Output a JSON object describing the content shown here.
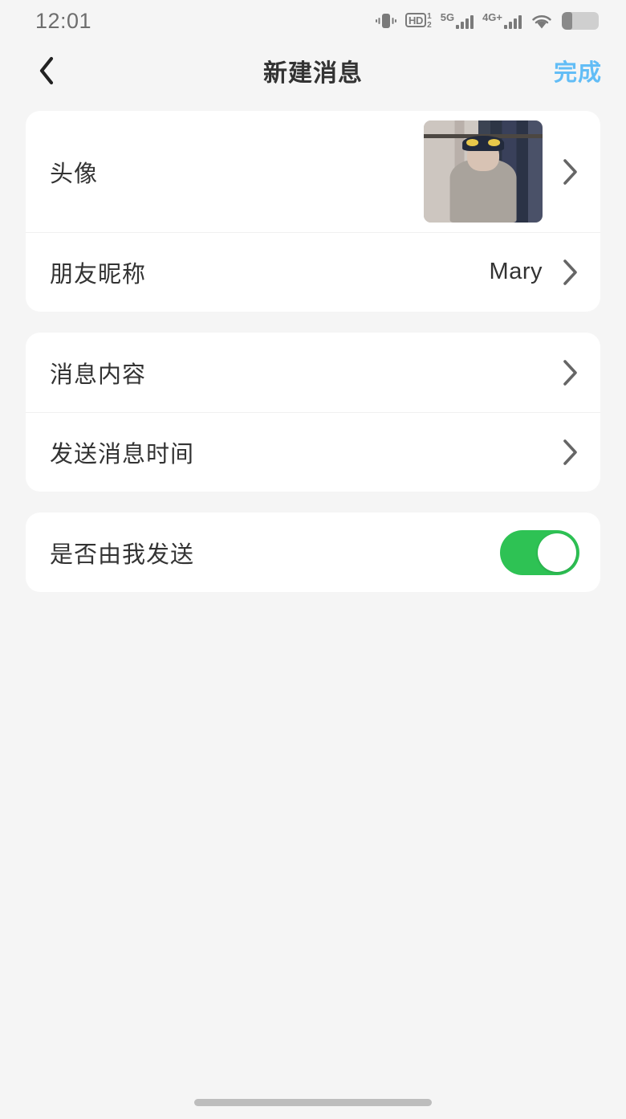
{
  "status_bar": {
    "time": "12:01",
    "icons": [
      {
        "name": "vibrate-icon"
      },
      {
        "name": "hd-voice-icon",
        "label": "HD",
        "sup": "1",
        "sub": "2"
      },
      {
        "name": "signal-5g-icon",
        "label": "5G"
      },
      {
        "name": "signal-4g-plus-icon",
        "label": "4G+"
      },
      {
        "name": "wifi-icon"
      },
      {
        "name": "battery-icon"
      }
    ]
  },
  "nav": {
    "back_icon": "chevron-left-icon",
    "title": "新建消息",
    "done_label": "完成",
    "done_color": "#62bdf6"
  },
  "colors": {
    "page_background": "#f5f5f5",
    "card_background": "#ffffff",
    "label_text": "#333333",
    "divider": "#f0f0f0",
    "toggle_on": "#2ec254",
    "accent": "#62bdf6",
    "chevron": "#666666"
  },
  "cards": [
    {
      "name": "profile-card",
      "rows": [
        {
          "name": "avatar-row",
          "label": "头像",
          "value": "",
          "control": "avatar-thumbnail",
          "chevron": true,
          "tall": true
        },
        {
          "name": "nickname-row",
          "label": "朋友昵称",
          "value": "Mary",
          "control": "text-value",
          "chevron": true,
          "tall": false
        }
      ]
    },
    {
      "name": "message-card",
      "rows": [
        {
          "name": "message-content-row",
          "label": "消息内容",
          "value": "",
          "control": "none",
          "chevron": true,
          "tall": false
        },
        {
          "name": "message-time-row",
          "label": "发送消息时间",
          "value": "",
          "control": "none",
          "chevron": true,
          "tall": false
        }
      ]
    },
    {
      "name": "sender-card",
      "rows": [
        {
          "name": "sent-by-me-row",
          "label": "是否由我发送",
          "value": "",
          "control": "toggle",
          "toggle_on": true,
          "chevron": false,
          "tall": false
        }
      ]
    }
  ],
  "home_indicator": {
    "name": "home-indicator"
  }
}
